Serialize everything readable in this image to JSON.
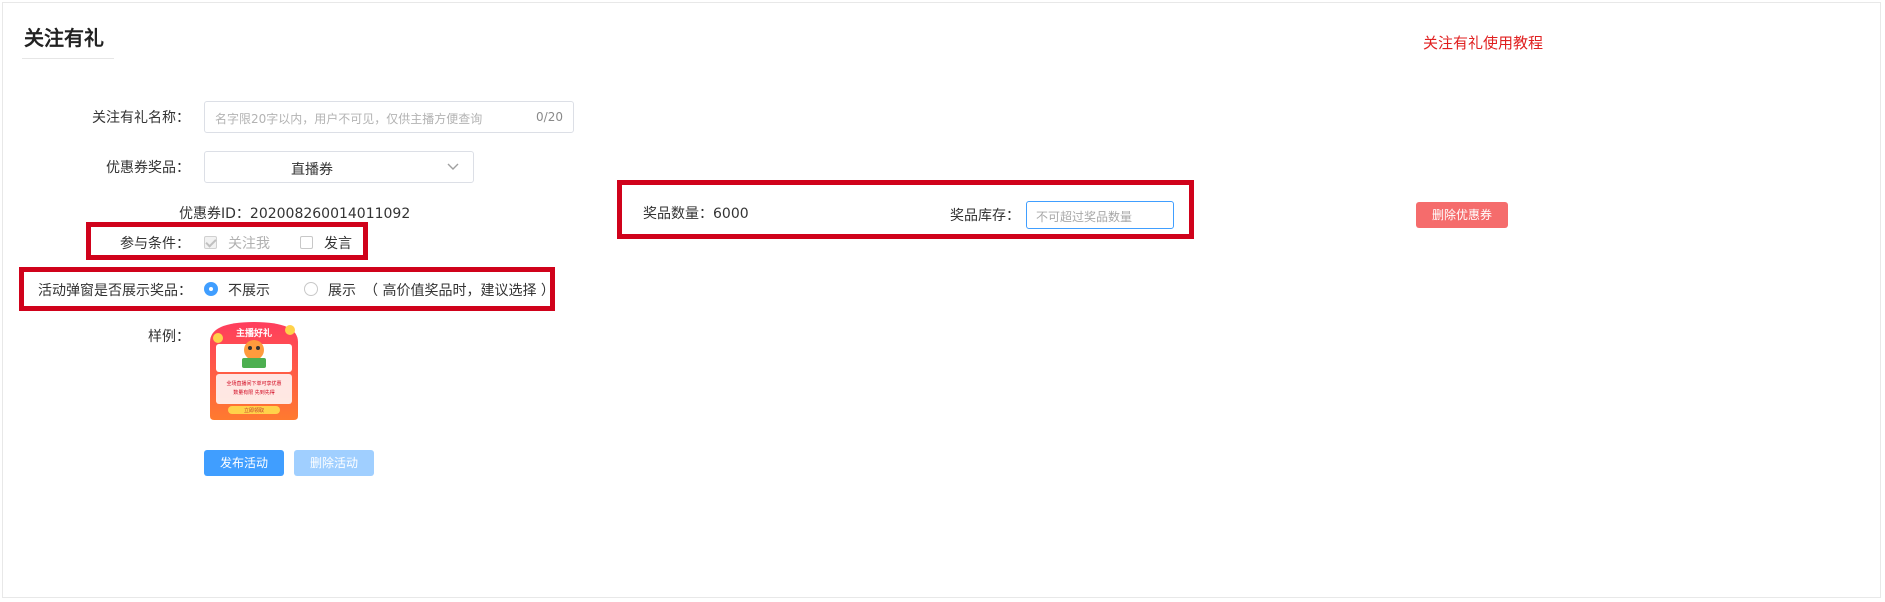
{
  "page": {
    "title": "关注有礼",
    "tutorial_link": "关注有礼使用教程"
  },
  "form": {
    "name_label": "关注有礼名称：",
    "name_placeholder": "名字限20字以内，用户不可见，仅供主播方便查询",
    "name_counter": "0/20",
    "coupon_label": "优惠券奖品：",
    "coupon_value": "直播券",
    "coupon_id": "优惠券ID：202008260014011092",
    "conditions_label": "参与条件：",
    "condition_follow": "关注我",
    "condition_comment": "发言",
    "popup_label": "活动弹窗是否展示奖品：",
    "popup_hide": "不展示",
    "popup_show": "展示",
    "popup_hint": "（ 高价值奖品时，建议选择 ）",
    "sample_label": "样例："
  },
  "prize": {
    "quantity_label": "奖品数量：6000",
    "stock_label": "奖品库存：",
    "stock_placeholder": "不可超过奖品数量",
    "delete_coupon_button": "删除优惠券"
  },
  "actions": {
    "publish": "发布活动",
    "delete": "删除活动"
  },
  "sample_card": {
    "header": "主播好礼",
    "line1": "全场直播间下单可享优惠",
    "line2": "数量有限 先到先得",
    "button": "立即领取"
  },
  "colors": {
    "accent": "#409eff",
    "danger": "#f56c6c",
    "highlight": "#d0021b",
    "link": "#e02020"
  }
}
